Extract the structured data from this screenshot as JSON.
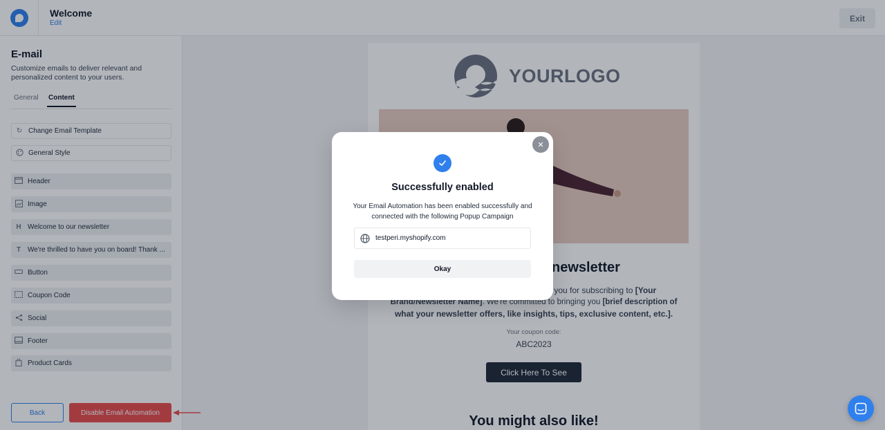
{
  "topbar": {
    "title": "Welcome",
    "edit_label": "Edit",
    "exit_label": "Exit"
  },
  "sidebar": {
    "title": "E-mail",
    "description": "Customize emails to deliver relevant and personalized content to your users.",
    "tabs": [
      {
        "label": "General",
        "active": false
      },
      {
        "label": "Content",
        "active": true
      }
    ],
    "items": [
      {
        "label": "Change Email Template",
        "icon": "refresh-icon"
      },
      {
        "label": "General Style",
        "icon": "palette-icon"
      },
      {
        "label": "Header",
        "icon": "header-icon"
      },
      {
        "label": "Image",
        "icon": "image-icon"
      },
      {
        "label": "Welcome to our newsletter",
        "icon": "heading-icon",
        "icon_glyph": "H"
      },
      {
        "label": "We're thrilled to have you on board! Thank ...",
        "icon": "text-icon",
        "icon_glyph": "T"
      },
      {
        "label": "Button",
        "icon": "button-icon"
      },
      {
        "label": "Coupon Code",
        "icon": "coupon-icon"
      },
      {
        "label": "Social",
        "icon": "share-icon"
      },
      {
        "label": "Footer",
        "icon": "footer-icon"
      },
      {
        "label": "Product Cards",
        "icon": "product-icon"
      }
    ],
    "back_label": "Back",
    "disable_label": "Disable Email Automation"
  },
  "email": {
    "logo_text": "YOURLOGO",
    "heading_visible": "newsletter",
    "body_line1_visible": "k you for subscribing to ",
    "body_line1_bold": "[Your",
    "body_line2_bold": "Brand/Newsletter Name]",
    "body_line2_rest": ". We're committed to bringing you ",
    "body_line2_bold2": "[brief description of",
    "body_line3_bold": "what your newsletter offers, like insights, tips, exclusive content, etc.].",
    "coupon_label": "Your coupon code:",
    "coupon_code": "ABC2023",
    "cta_label": "Click Here To See",
    "also_like": "You might also like!"
  },
  "modal": {
    "title": "Successfully enabled",
    "description": "Your Email Automation has been enabled successfully and connected with the following Popup Campaign",
    "site": "testperi.myshopify.com",
    "okay_label": "Okay"
  },
  "colors": {
    "accent": "#2f80ed",
    "danger": "#e74c4c",
    "dark_button": "#1f2937"
  }
}
